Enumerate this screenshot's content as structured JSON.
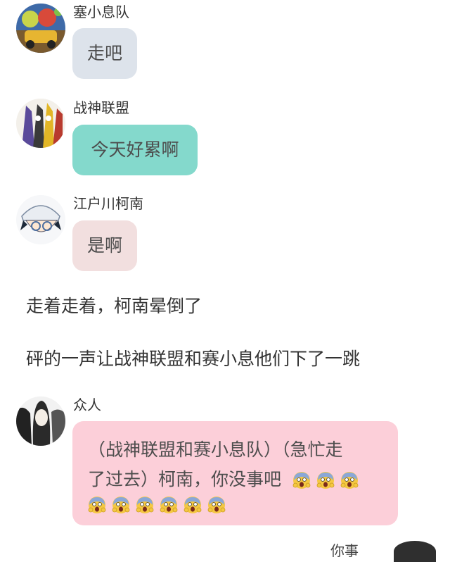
{
  "messages": [
    {
      "sender": "塞小息队",
      "text": "走吧",
      "bubble_color": "#dde3eb"
    },
    {
      "sender": "战神联盟",
      "text": "今天好累啊",
      "bubble_color": "#84d9cc"
    },
    {
      "sender": "江户川柯南",
      "text": "是啊",
      "bubble_color": "#f2dfdf"
    }
  ],
  "narration": [
    "走着走着，柯南晕倒了",
    "砰的一声让战神联盟和赛小息他们下了一跳"
  ],
  "group_message": {
    "sender": "众人",
    "line1": "（战神联盟和赛小息队）（急忙走",
    "line2": "了过去）柯南，你没事吧",
    "bubble_color": "#fccfd9",
    "inline_emoji": "screaming-face-icon",
    "inline_emoji_count": 3,
    "row_emoji_count": 6
  },
  "footer_partial_text": "你事"
}
